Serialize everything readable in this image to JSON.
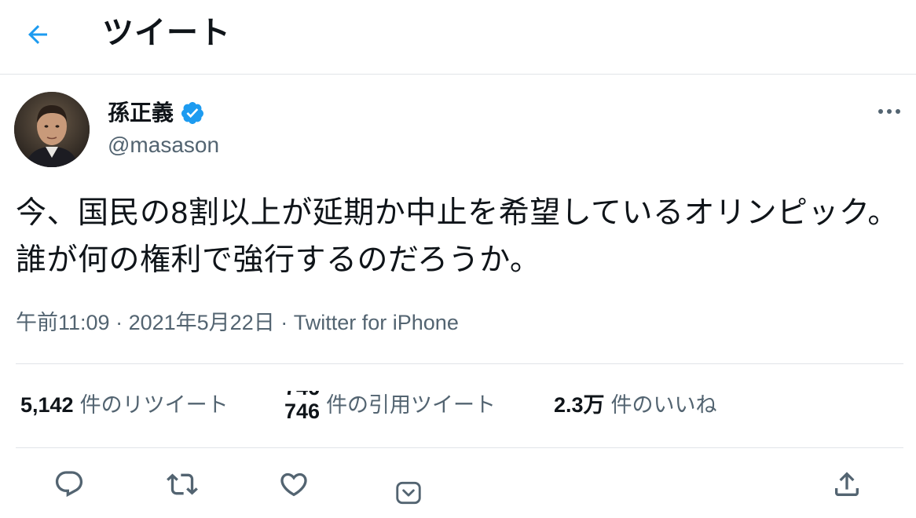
{
  "header": {
    "title": "ツイート",
    "back_icon": "arrow-left-icon",
    "accent_color": "#1d9bf0"
  },
  "author": {
    "name": "孫正義",
    "handle": "@masason",
    "verified": true,
    "verified_icon": "verified-badge-icon"
  },
  "tweet": {
    "text": "今、国民の8割以上が延期か中止を希望しているオリンピック。誰が何の権利で強行するのだろうか。",
    "time": "午前11:09",
    "date": "2021年5月22日",
    "source": "Twitter for iPhone",
    "separator": "·"
  },
  "stats": {
    "retweets": {
      "count": "5,142",
      "label": "件のリツイート"
    },
    "quotes": {
      "count": "746",
      "label": "件の引用ツイート"
    },
    "likes": {
      "count": "2.3万",
      "label": "件のいいね"
    }
  },
  "actions": [
    "reply-icon",
    "retweet-icon",
    "like-icon",
    "bookmark-icon",
    "share-icon"
  ],
  "colors": {
    "text_primary": "#0f1419",
    "text_secondary": "#536471",
    "icon": "#536471",
    "divider": "#e1e4e8"
  }
}
